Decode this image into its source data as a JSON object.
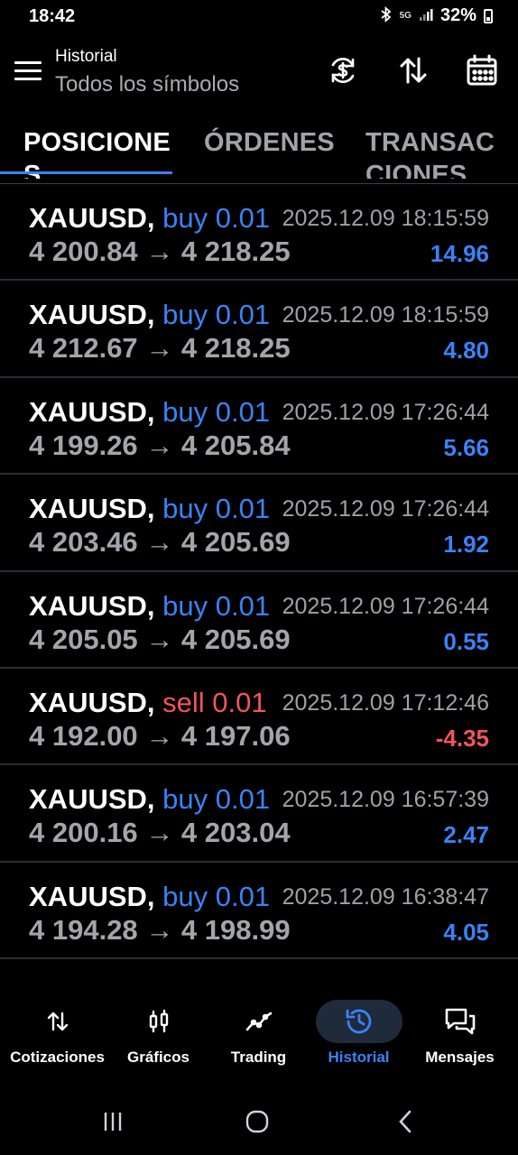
{
  "status": {
    "time": "18:42",
    "network": "5G",
    "battery": "32%"
  },
  "header": {
    "title": "Historial",
    "subtitle": "Todos los símbolos",
    "icons": [
      "currency-sync-icon",
      "sort-icon",
      "calendar-icon"
    ]
  },
  "tabs": [
    {
      "label": "POSICIONES",
      "active": true
    },
    {
      "label": "ÓRDENES",
      "active": false
    },
    {
      "label": "TRANSACCIONES",
      "active": false
    }
  ],
  "positions": [
    {
      "symbol": "XAUUSD,",
      "side": "buy 0.01",
      "type": "buy",
      "time": "2025.12.09 18:15:59",
      "prices": "4 200.84 → 4 218.25",
      "profit": "14.96"
    },
    {
      "symbol": "XAUUSD,",
      "side": "buy 0.01",
      "type": "buy",
      "time": "2025.12.09 18:15:59",
      "prices": "4 212.67 → 4 218.25",
      "profit": "4.80"
    },
    {
      "symbol": "XAUUSD,",
      "side": "buy 0.01",
      "type": "buy",
      "time": "2025.12.09 17:26:44",
      "prices": "4 199.26 → 4 205.84",
      "profit": "5.66"
    },
    {
      "symbol": "XAUUSD,",
      "side": "buy 0.01",
      "type": "buy",
      "time": "2025.12.09 17:26:44",
      "prices": "4 203.46 → 4 205.69",
      "profit": "1.92"
    },
    {
      "symbol": "XAUUSD,",
      "side": "buy 0.01",
      "type": "buy",
      "time": "2025.12.09 17:26:44",
      "prices": "4 205.05 → 4 205.69",
      "profit": "0.55"
    },
    {
      "symbol": "XAUUSD,",
      "side": "sell 0.01",
      "type": "sell",
      "time": "2025.12.09 17:12:46",
      "prices": "4 192.00 → 4 197.06",
      "profit": "-4.35"
    },
    {
      "symbol": "XAUUSD,",
      "side": "buy 0.01",
      "type": "buy",
      "time": "2025.12.09 16:57:39",
      "prices": "4 200.16 → 4 203.04",
      "profit": "2.47"
    },
    {
      "symbol": "XAUUSD,",
      "side": "buy 0.01",
      "type": "buy",
      "time": "2025.12.09 16:38:47",
      "prices": "4 194.28 → 4 198.99",
      "profit": "4.05"
    }
  ],
  "bottom_nav": [
    {
      "label": "Cotizaciones",
      "icon": "quotes-arrows-icon",
      "active": false
    },
    {
      "label": "Gráficos",
      "icon": "candlestick-icon",
      "active": false
    },
    {
      "label": "Trading",
      "icon": "trend-line-icon",
      "active": false
    },
    {
      "label": "Historial",
      "icon": "history-clock-icon",
      "active": true
    },
    {
      "label": "Mensajes",
      "icon": "chat-bubbles-icon",
      "active": false
    }
  ],
  "colors": {
    "accent": "#3a82f7",
    "loss": "#f2555a",
    "background": "#000000",
    "muted": "#a2a6ac"
  }
}
